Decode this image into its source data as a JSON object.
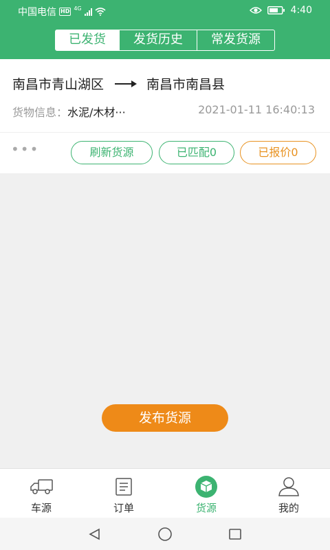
{
  "status_bar": {
    "carrier": "中国电信",
    "hd": "HD",
    "network": "4G",
    "time": "4:40"
  },
  "header": {
    "tabs": [
      {
        "label": "已发货"
      },
      {
        "label": "发货历史"
      },
      {
        "label": "常发货源"
      }
    ]
  },
  "card": {
    "from": "南昌市青山湖区",
    "to": "南昌市南昌县",
    "cargo_label": "货物信息：",
    "cargo_value": "水泥/木材···",
    "time": "2021-01-11 16:40:13",
    "more": "•••",
    "buttons": {
      "refresh": "刷新货源",
      "matched": "已匹配0",
      "quoted": "已报价0"
    }
  },
  "publish_label": "发布货源",
  "tabbar": {
    "items": [
      {
        "label": "车源",
        "icon": "truck-icon"
      },
      {
        "label": "订单",
        "icon": "order-list-icon"
      },
      {
        "label": "货源",
        "icon": "cargo-box-icon"
      },
      {
        "label": "我的",
        "icon": "user-icon"
      }
    ]
  },
  "colors": {
    "primary": "#3cb371",
    "accent": "#ee8a18"
  }
}
